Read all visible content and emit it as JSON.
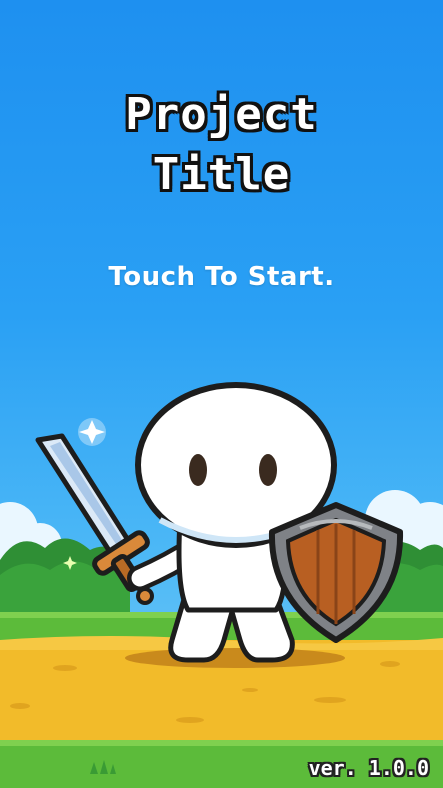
{
  "game": {
    "title_line1": "Project",
    "title_line2": "Title",
    "prompt": "Touch To Start.",
    "version": "ver. 1.0.0"
  },
  "colors": {
    "sky_top": "#1e90f0",
    "grass": "#3da83a",
    "ground": "#f2bb2a",
    "shield_wood": "#b85f22"
  },
  "icons": [
    "sword-icon",
    "shield-icon",
    "sparkle-icon"
  ]
}
